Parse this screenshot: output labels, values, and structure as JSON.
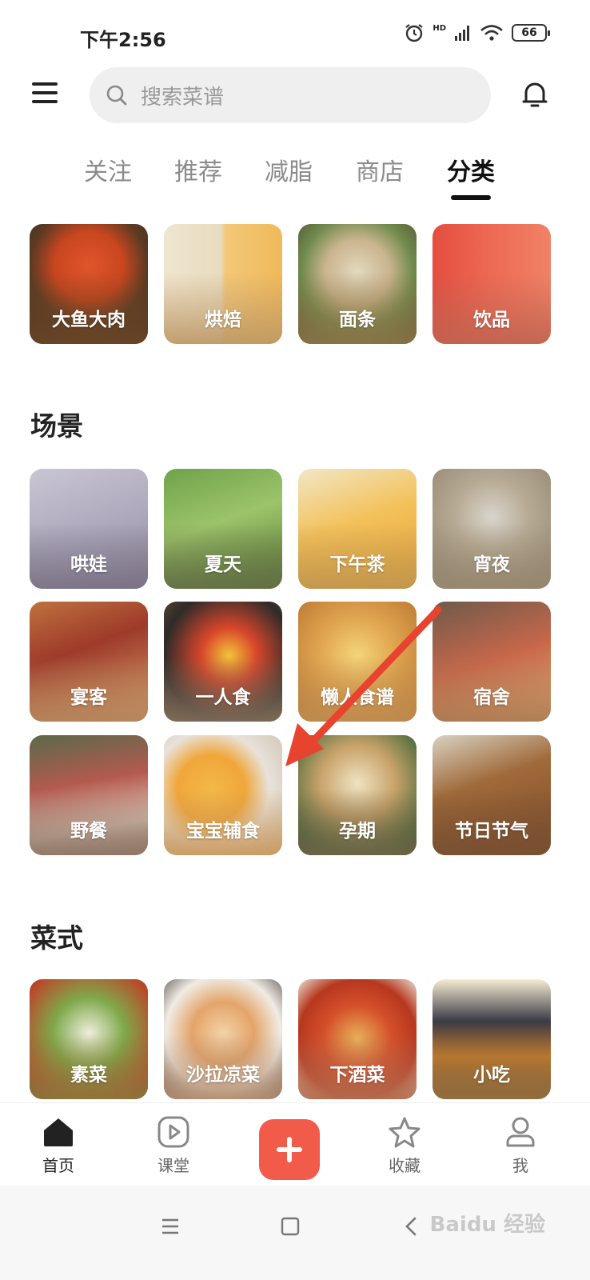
{
  "status_bar": {
    "time": "下午2:56",
    "battery": "66",
    "network": "HD",
    "icons": [
      "alarm-icon",
      "signal-icon",
      "wifi-icon",
      "battery-icon"
    ]
  },
  "header": {
    "menu_icon": "menu-icon",
    "search_placeholder": "搜索菜谱",
    "bell_icon": "bell-icon"
  },
  "tabs": [
    {
      "label": "关注",
      "active": false
    },
    {
      "label": "推荐",
      "active": false
    },
    {
      "label": "减脂",
      "active": false
    },
    {
      "label": "商店",
      "active": false
    },
    {
      "label": "分类",
      "active": true
    }
  ],
  "categories_top": [
    {
      "label": "大鱼大肉"
    },
    {
      "label": "烘焙"
    },
    {
      "label": "面条"
    },
    {
      "label": "饮品"
    }
  ],
  "scene": {
    "title": "场景",
    "items": [
      {
        "label": "哄娃"
      },
      {
        "label": "夏天"
      },
      {
        "label": "下午茶"
      },
      {
        "label": "宵夜"
      },
      {
        "label": "宴客"
      },
      {
        "label": "一人食"
      },
      {
        "label": "懒人食谱"
      },
      {
        "label": "宿舍"
      },
      {
        "label": "野餐"
      },
      {
        "label": "宝宝辅食"
      },
      {
        "label": "孕期"
      },
      {
        "label": "节日节气"
      }
    ]
  },
  "style": {
    "title": "菜式",
    "items": [
      {
        "label": "素菜"
      },
      {
        "label": "沙拉凉菜"
      },
      {
        "label": "下酒菜"
      },
      {
        "label": "小吃"
      }
    ]
  },
  "bottom_nav": [
    {
      "label": "首页",
      "icon": "home-icon",
      "active": true
    },
    {
      "label": "课堂",
      "icon": "play-icon",
      "active": false
    },
    {
      "label": "",
      "icon": "plus-icon",
      "active": false
    },
    {
      "label": "收藏",
      "icon": "star-icon",
      "active": false
    },
    {
      "label": "我",
      "icon": "person-icon",
      "active": false
    }
  ],
  "colors": {
    "accent": "#f25a4a",
    "annotation_arrow": "#e8432f"
  },
  "watermark": "Baidu 经验"
}
